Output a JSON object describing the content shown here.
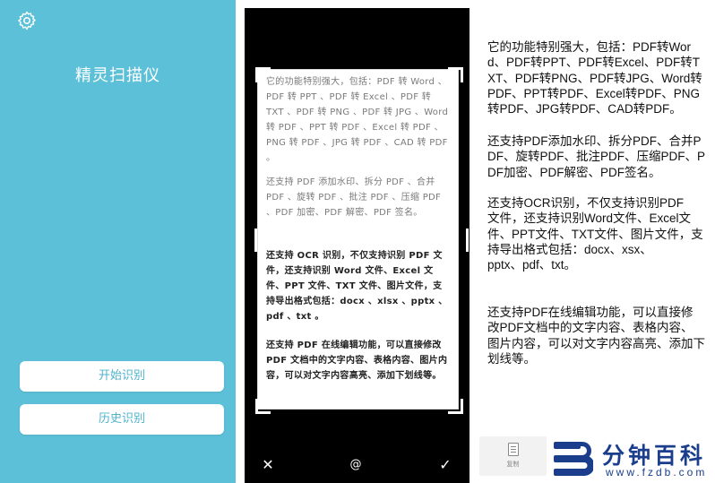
{
  "home": {
    "settings_icon": "gear-icon",
    "app_title": "精灵扫描仪",
    "start_button": "开始识别",
    "history_button": "历史识别",
    "colors": {
      "background": "#5bc0d8",
      "button_text": "#4fb3cc"
    }
  },
  "scanner": {
    "paragraphs": [
      "它的功能特别强大，包括：PDF 转 Word 、PDF 转 PPT 、PDF 转 Excel 、PDF 转 TXT 、PDF 转 PNG 、PDF 转 JPG 、Word 转 PDF 、PPT 转 PDF 、Excel 转 PDF 、PNG 转 PDF 、JPG 转 PDF 、CAD 转 PDF 。",
      "还支持 PDF 添加水印、拆分 PDF 、合并 PDF 、旋转 PDF 、批注 PDF 、压缩 PDF 、PDF 加密、PDF 解密、PDF 签名。",
      "还支持 OCR 识别，不仅支持识别 PDF 文件，还支持识别 Word 文件、Excel 文件、PPT 文件、TXT 文件、图片文件，支持导出格式包括：docx 、xlsx 、pptx 、pdf 、txt 。",
      "还支持 PDF 在线编辑功能，可以直接修改 PDF 文档中的文字内容、表格内容、图片内容，可以对文字内容高亮、添加下划线等。"
    ],
    "tools": {
      "close": "✕",
      "rotate": "@",
      "confirm": "✓"
    },
    "tool_icons": [
      "close-icon",
      "rotate-icon",
      "check-icon"
    ]
  },
  "result": {
    "paragraphs": [
      "它的功能特别强大，包括：PDF转Word、PDF转PPT、PDF转Excel、PDF转TXT、PDF转PNG、PDF转JPG、Word转PDF、PPT转PDF、Excel转PDF、PNG转PDF、JPG转PDF、CAD转PDF。",
      "还支持PDF添加水印、拆分PDF、合并PDF、旋转PDF、批注PDF、压缩PDF、PDF加密、PDF解密、PDF签名。",
      "还支持OCR识别，不仅支持识别PDF\n文件，还支持识别Word文件、Excel文件、PPT文件、TXT文件、图片文件，支持导出格式包括：docx、xsx、\npptx、pdf、txt。",
      "还支持PDF在线编辑功能，可以直接修\n改PDF文档中的文字内容、表格内容、\n图片内容，可以对文字内容高亮、添加下\n划线等。"
    ],
    "copy_label": "复制",
    "copy_icon": "document-icon"
  },
  "watermark": {
    "brand": "分钟百科",
    "url": "www.fzdb.com",
    "color": "#1a3e8c"
  }
}
